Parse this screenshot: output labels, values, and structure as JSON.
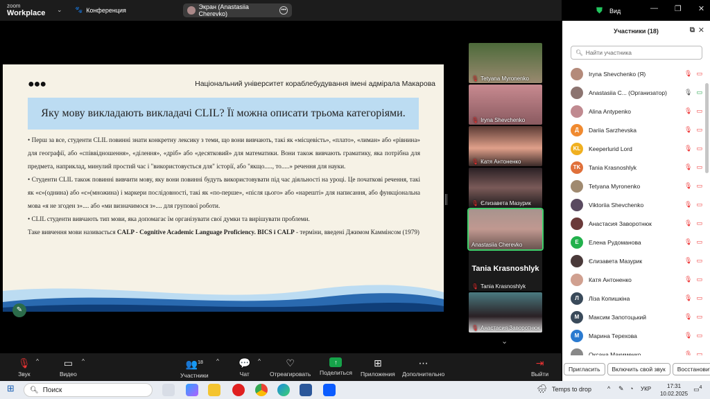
{
  "app": {
    "logo_small": "zoom",
    "logo_big": "Workplace",
    "conference_label": "Конференция",
    "screen_pill": "Экран (Anastasiia Cherevko)",
    "view_label": "Вид"
  },
  "slide": {
    "university": "Національний університет кораблебудування імені адмірала Макарова",
    "question": "Яку мову викладають викладачі CLIL? Її можна описати трьома категоріями.",
    "paragraphs": [
      "• Перш за все, студенти CLIL повинні знати конкретну лексику з теми, що вони вивчають, такі як «місцевість», «плато», «лиман» або «рівнина» для географії, або «співвідношення», «ділення», «дріб» або «десятковий» для математики. Вони також вивчають граматику, яка потрібна для предмета, наприклад, минулий простий час і \"використовується для\" історії, або \"якщо....., то.....» речення для науки.",
      "• Студенти CLIL також повинні вивчити мову, яку вони повинні будуть використовувати під час діяльності на уроці. Це початкові речення, такі як «є»(однина) або «є»(множина) і маркери послідовності, такі як «по-перше», «після цього» або «нарешті» для написання, або функціональна мова «я не згоден з».... або «ми визначимося з».... для групової роботи.",
      "• CLIL студенти вивчають тип мови, яка допомагає їм організувати свої думки та вирішувати проблеми."
    ],
    "final_pre": "Таке вивчення мови називається ",
    "final_bold": "CALP - Cognitive Academic Language Proficiency. BICS і CALP",
    "final_post": " - терміни, введені Джимом Каммінсом (1979)"
  },
  "video_tiles": [
    {
      "name": "Tetyana Myronenko",
      "bg": "#8a7a60"
    },
    {
      "name": "Iryna Shevchenko",
      "bg": "#b07a80"
    },
    {
      "name": "Катя Антоненко",
      "bg": "#6a4a44"
    },
    {
      "name": "Єлизавета Мазурик",
      "bg": "#3a2c30"
    },
    {
      "name": "Anastasiia Cherevko",
      "bg": "#8c7470"
    },
    {
      "name": "Tania Krasnoshlyk",
      "bg": "#1b1b1b",
      "big": "Tania Krasnoshlyk"
    },
    {
      "name": "Анастасия Заворотнюк",
      "bg": "#2d4a50"
    }
  ],
  "toolbar": {
    "audio": "Звук",
    "video": "Видео",
    "participants": "Участники",
    "participants_count": "18",
    "chat": "Чат",
    "react": "Отреагировать",
    "share": "Поделиться",
    "apps": "Приложения",
    "more": "Дополнительно",
    "leave": "Выйти"
  },
  "panel": {
    "title": "Участники (18)",
    "search_placeholder": "Найти участника",
    "participants": [
      {
        "name": "Iryna Shevchenko (Я)",
        "initial": "",
        "color": "#b48a7a"
      },
      {
        "name": "Anastasiia C... (Организатор)",
        "initial": "",
        "color": "#8c7470"
      },
      {
        "name": "Alina Antypenko",
        "initial": "",
        "color": "#c08a90"
      },
      {
        "name": "Dariia Sarzhevska",
        "initial": "Д",
        "color": "#f08a30"
      },
      {
        "name": "Keeperlurid Lord",
        "initial": "KL",
        "color": "#f0b020"
      },
      {
        "name": "Tania Krasnoshlyk",
        "initial": "TK",
        "color": "#e0703a"
      },
      {
        "name": "Tetyana Myronenko",
        "initial": "",
        "color": "#a08a70"
      },
      {
        "name": "Viktoriia Shevchenko",
        "initial": "",
        "color": "#5a4a60"
      },
      {
        "name": "Анастасия Заворотнюк",
        "initial": "",
        "color": "#6a3a3a"
      },
      {
        "name": "Елена Рудоманова",
        "initial": "Е",
        "color": "#22b14c"
      },
      {
        "name": "Єлизавета Мазурик",
        "initial": "",
        "color": "#4a3a3a"
      },
      {
        "name": "Катя Антоненко",
        "initial": "",
        "color": "#d0a090"
      },
      {
        "name": "Ліза Копишкіна",
        "initial": "Л",
        "color": "#3a4a5a"
      },
      {
        "name": "Максим Запотоцький",
        "initial": "М",
        "color": "#3a4a5a"
      },
      {
        "name": "Марина Терехова",
        "initial": "М",
        "color": "#2a7ad0"
      },
      {
        "name": "Оксана Макименко",
        "initial": "",
        "color": "#888"
      }
    ],
    "btn_invite": "Пригласить",
    "btn_sound": "Включить свой звук",
    "btn_restore": "Восстановить"
  },
  "taskbar": {
    "search": "Поиск",
    "weather": "Temps to drop",
    "lang": "УКР",
    "time": "17:31",
    "date": "10.02.2025",
    "notif": "4"
  }
}
